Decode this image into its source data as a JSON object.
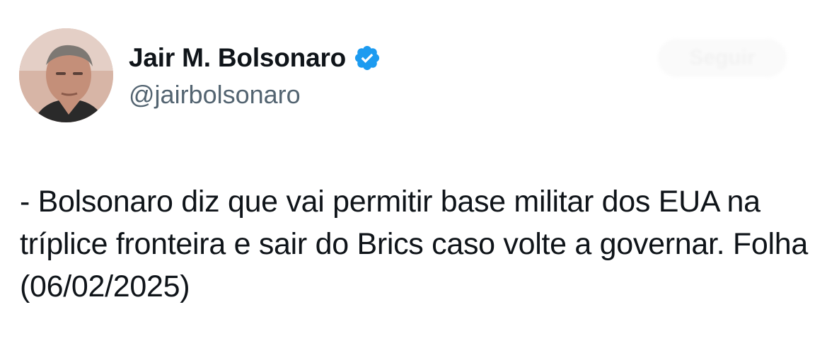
{
  "author": {
    "display_name": "Jair M. Bolsonaro",
    "handle": "@jairbolsonaro",
    "verified": true,
    "verified_color": "#1d9bf0"
  },
  "follow_button": {
    "label": "Seguir"
  },
  "tweet": {
    "text": "- Bolsonaro diz que vai permitir base militar dos EUA na tríplice fronteira e sair do Brics caso volte a governar. Folha (06/02/2025)"
  },
  "icons": {
    "verified": "verified-badge-icon",
    "avatar": "profile-photo"
  }
}
